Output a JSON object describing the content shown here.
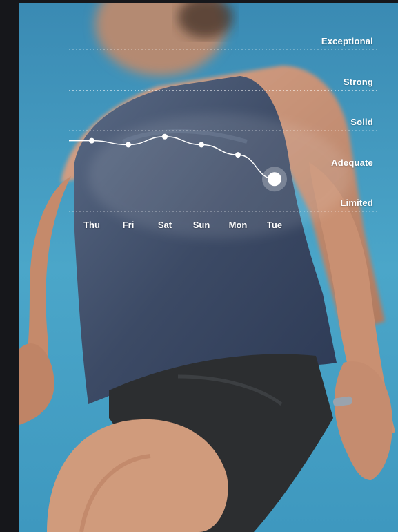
{
  "colors": {
    "background": "#16171b",
    "sky": "#4aa3c7",
    "line": "#ffffff",
    "gridline": "#ffffff"
  },
  "chart_data": {
    "type": "line",
    "x": [
      "Thu",
      "Fri",
      "Sat",
      "Sun",
      "Mon",
      "Tue"
    ],
    "y_levels": [
      "Limited",
      "Adequate",
      "Solid",
      "Strong",
      "Exceptional"
    ],
    "series": [
      {
        "values": [
          2.75,
          2.65,
          2.85,
          2.65,
          2.4,
          1.8
        ]
      }
    ],
    "ylim": [
      1,
      5
    ],
    "grid": true,
    "highlighted_point": "Tue"
  }
}
